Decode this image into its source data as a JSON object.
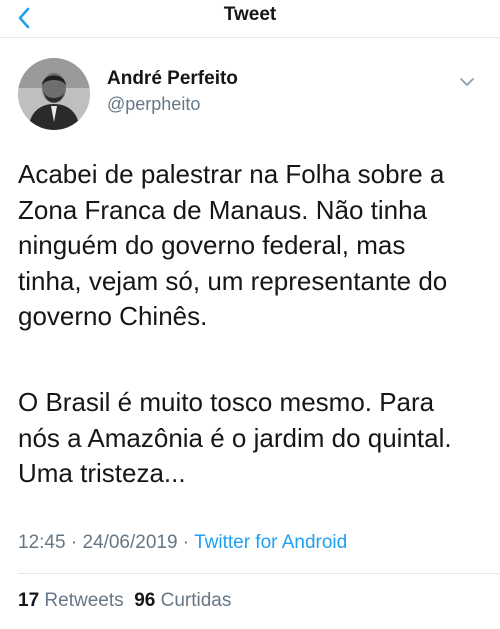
{
  "nav": {
    "title": "Tweet"
  },
  "author": {
    "name": "André Perfeito",
    "handle": "@perpheito"
  },
  "tweet": {
    "paragraph1": "Acabei de palestrar na Folha sobre a\nZona Franca de Manaus. Não tinha\nninguém do governo federal, mas\ntinha, vejam só, um representante do\ngoverno Chinês.",
    "paragraph2": "O Brasil é muito tosco mesmo. Para\nnós a Amazônia é o jardim do quintal.\nUma tristeza..."
  },
  "meta": {
    "time": "12:45",
    "sep1": " · ",
    "date": "24/06/2019",
    "sep2": " · ",
    "source": "Twitter for Android"
  },
  "stats": {
    "retweets_count": "17",
    "retweets_label": "Retweets",
    "likes_count": "96",
    "likes_label": "Curtidas"
  },
  "colors": {
    "link": "#1da1f2",
    "muted": "#657786",
    "text": "#14171a"
  },
  "icons": {
    "back": "chevron-left-icon",
    "more": "chevron-down-icon"
  }
}
